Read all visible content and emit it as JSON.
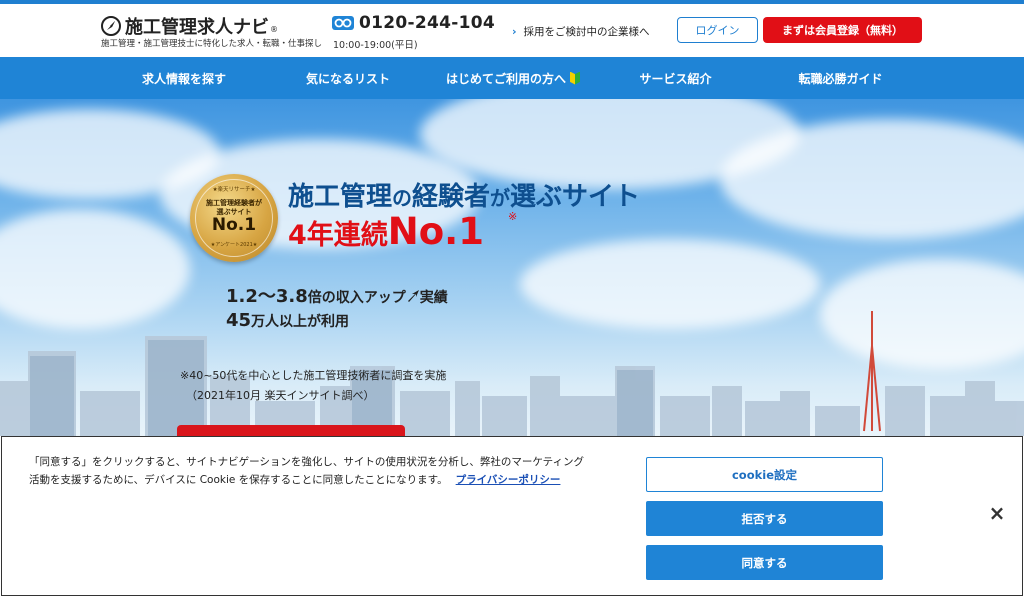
{
  "header": {
    "logo_text": "施工管理求人ナビ",
    "logo_reg": "®",
    "logo_sub": "施工管理・施工管理技士に特化した求人・転職・仕事探し",
    "phone_number": "0120-244-104",
    "phone_hours": "10:00-19:00(平日)",
    "employer_link": "採用をご検討中の企業様へ",
    "login_label": "ログイン",
    "register_label": "まずは会員登録（無料）"
  },
  "nav": {
    "items": [
      {
        "label": "求人情報を探す"
      },
      {
        "label": "気になるリスト"
      },
      {
        "label": "はじめてご利用の方へ"
      },
      {
        "label": "サービス紹介"
      },
      {
        "label": "転職必勝ガイド"
      }
    ]
  },
  "hero": {
    "badge": {
      "top": "★楽天リサーチ★",
      "line1": "施工管理経験者が",
      "line2": "選ぶサイト",
      "no1": "No.1",
      "bottom": "★アンケート2021★"
    },
    "headline1": {
      "a": "施工管理",
      "b": "の",
      "c": "経験者",
      "d": "が",
      "e": "選ぶ",
      "f": "サイト"
    },
    "headline2": {
      "a": "4年",
      "b": "連続",
      "c": "No.1",
      "star": "※"
    },
    "stat1": {
      "num": "1.2〜3.8",
      "txt1": "倍の収入アップ",
      "txt2": "実績"
    },
    "stat2": {
      "num": "45",
      "txt": "万人以上が利用"
    },
    "note1": "※40~50代を中心とした施工管理技術者に調査を実施",
    "note2": "（2021年10月 楽天インサイト調べ）"
  },
  "cookie": {
    "text_line1": "「同意する」をクリックすると、サイトナビゲーションを強化し、サイトの使用状況を分析し、弊社のマーケティング",
    "text_line2": "活動を支援するために、デバイスに Cookie を保存することに同意したことになります。",
    "policy_link": "プライバシーポリシー",
    "settings_label": "cookie設定",
    "reject_label": "拒否する",
    "accept_label": "同意する",
    "close_label": "×"
  },
  "colors": {
    "brand_blue": "#1f84d6",
    "brand_red": "#e10f16",
    "headline_blue": "#0e4f8f"
  }
}
